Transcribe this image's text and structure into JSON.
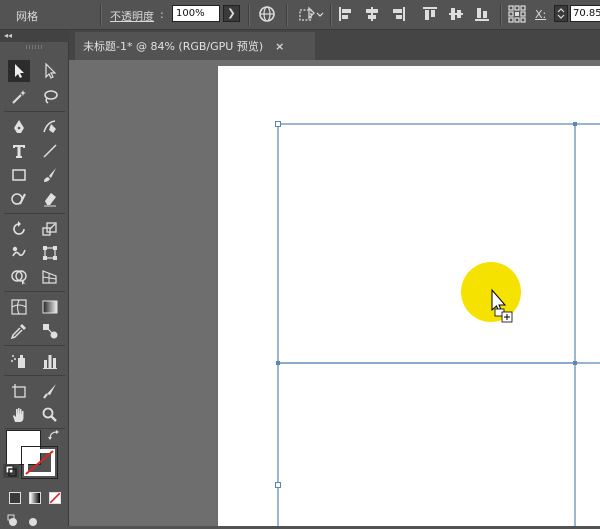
{
  "control_bar": {
    "grid_label": "网格",
    "opacity_label": "不透明度",
    "opacity_colon": ":",
    "opacity_value": "100%",
    "x_label": "X:",
    "x_value": "70.85"
  },
  "document_tab": {
    "title": "未标题-1* @ 84% (RGB/GPU 预览)",
    "close": "×"
  },
  "tools_panel": {
    "collapse": "◂◂"
  },
  "colors": {
    "ui_background": "#535353",
    "canvas_background": "#6e6e6e",
    "artboard": "#ffffff",
    "grid_line": "#5b87b4",
    "circle_fill": "#f6e200"
  }
}
